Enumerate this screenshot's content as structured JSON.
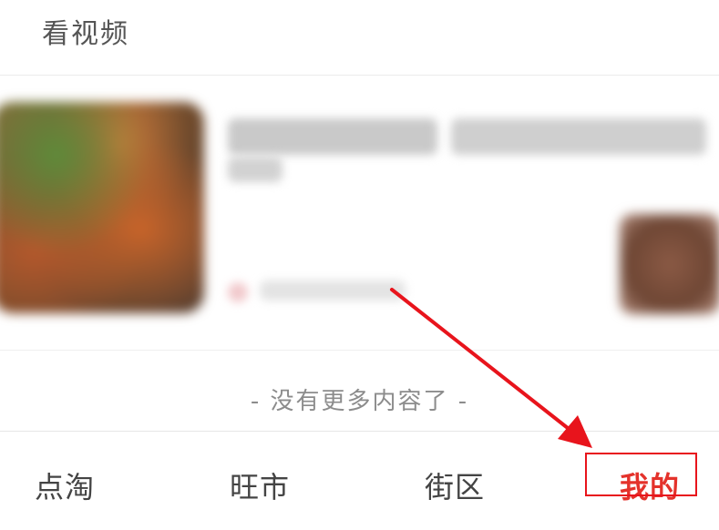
{
  "header": {
    "title": "看视频"
  },
  "feed": {
    "end_text": "- 没有更多内容了 -"
  },
  "tabbar": {
    "tabs": [
      {
        "label": "点淘",
        "active": false
      },
      {
        "label": "旺市",
        "active": false
      },
      {
        "label": "街区",
        "active": false
      },
      {
        "label": "我的",
        "active": true
      }
    ]
  },
  "annotation": {
    "highlight_color": "#e8141c",
    "arrow_color": "#e8141c"
  },
  "colors": {
    "active_tab": "#e4322b",
    "inactive_tab": "#444444"
  }
}
